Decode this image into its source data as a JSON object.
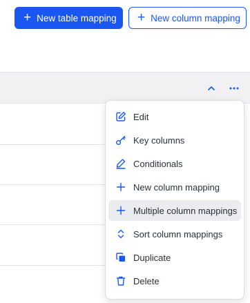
{
  "toolbar": {
    "new_table_mapping": "New table mapping",
    "new_column_mapping": "New column mapping"
  },
  "panel": {
    "collapse_icon": "chevron-up-icon",
    "more_icon": "ellipsis-icon"
  },
  "menu": {
    "items": [
      {
        "label": "Edit",
        "icon": "edit-icon"
      },
      {
        "label": "Key columns",
        "icon": "key-icon"
      },
      {
        "label": "Conditionals",
        "icon": "pencil-icon"
      },
      {
        "label": "New column mapping",
        "icon": "plus-icon"
      },
      {
        "label": "Multiple column mappings",
        "icon": "plus-icon"
      },
      {
        "label": "Sort column mappings",
        "icon": "sort-icon"
      },
      {
        "label": "Duplicate",
        "icon": "duplicate-icon"
      },
      {
        "label": "Delete",
        "icon": "trash-icon"
      }
    ],
    "highlighted_item": "Multiple column mappings"
  },
  "colors": {
    "accent": "#1a56f0",
    "header_bg": "#f1f1f3",
    "highlight_bg": "#ebecf0"
  }
}
